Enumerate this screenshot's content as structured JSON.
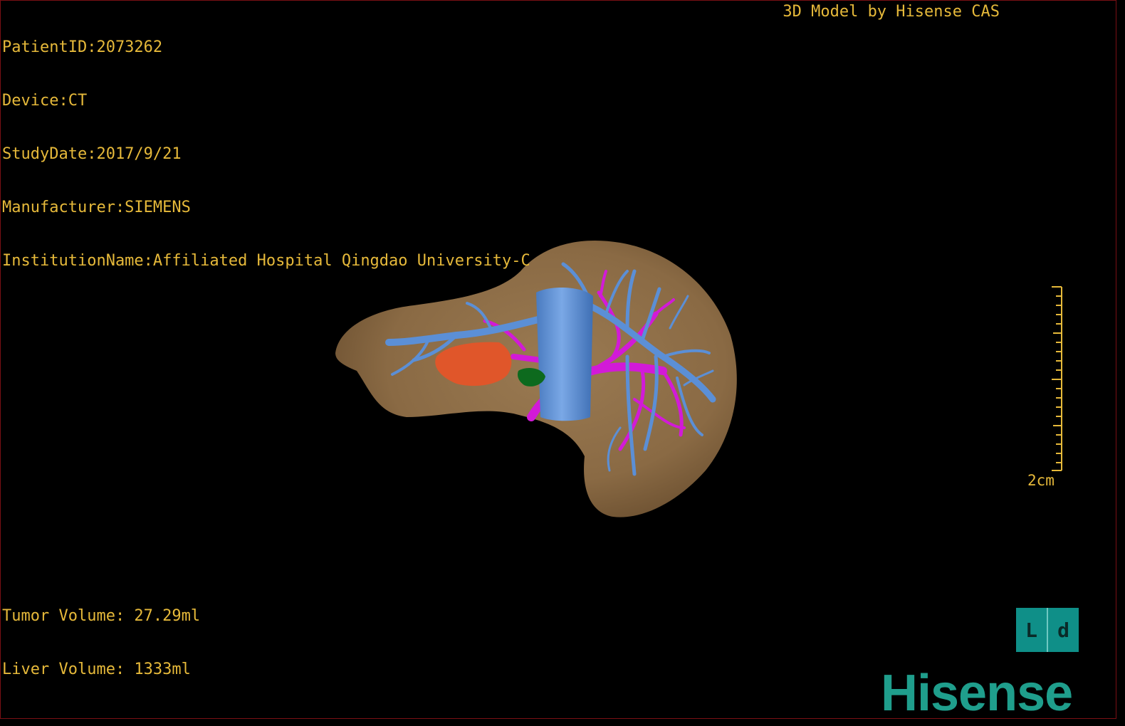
{
  "header": {
    "patient_id": "PatientID:2073262",
    "device": "Device:CT",
    "study_date": "StudyDate:2017/9/21",
    "manufacturer": "Manufacturer:SIEMENS",
    "institution": "InstitutionName:Affiliated Hospital Qingdao University-C",
    "model_credit": "3D Model by Hisense CAS"
  },
  "footer": {
    "tumor_volume": "Tumor Volume: 27.29ml",
    "liver_volume": "Liver Volume: 1333ml"
  },
  "scale_bar": {
    "label": "2cm"
  },
  "orientation_cube": {
    "left_face": "L",
    "right_face": "d"
  },
  "brand": {
    "name": "Hisense"
  },
  "colors": {
    "overlay_text": "#e6b93a",
    "liver": "#8b6b45",
    "vessel_blue": "#5b8fd6",
    "vessel_magenta": "#d21ad8",
    "tumor": "#e0562a",
    "gallbladder": "#0d6a1e",
    "brand_teal": "#1f9e8c"
  }
}
